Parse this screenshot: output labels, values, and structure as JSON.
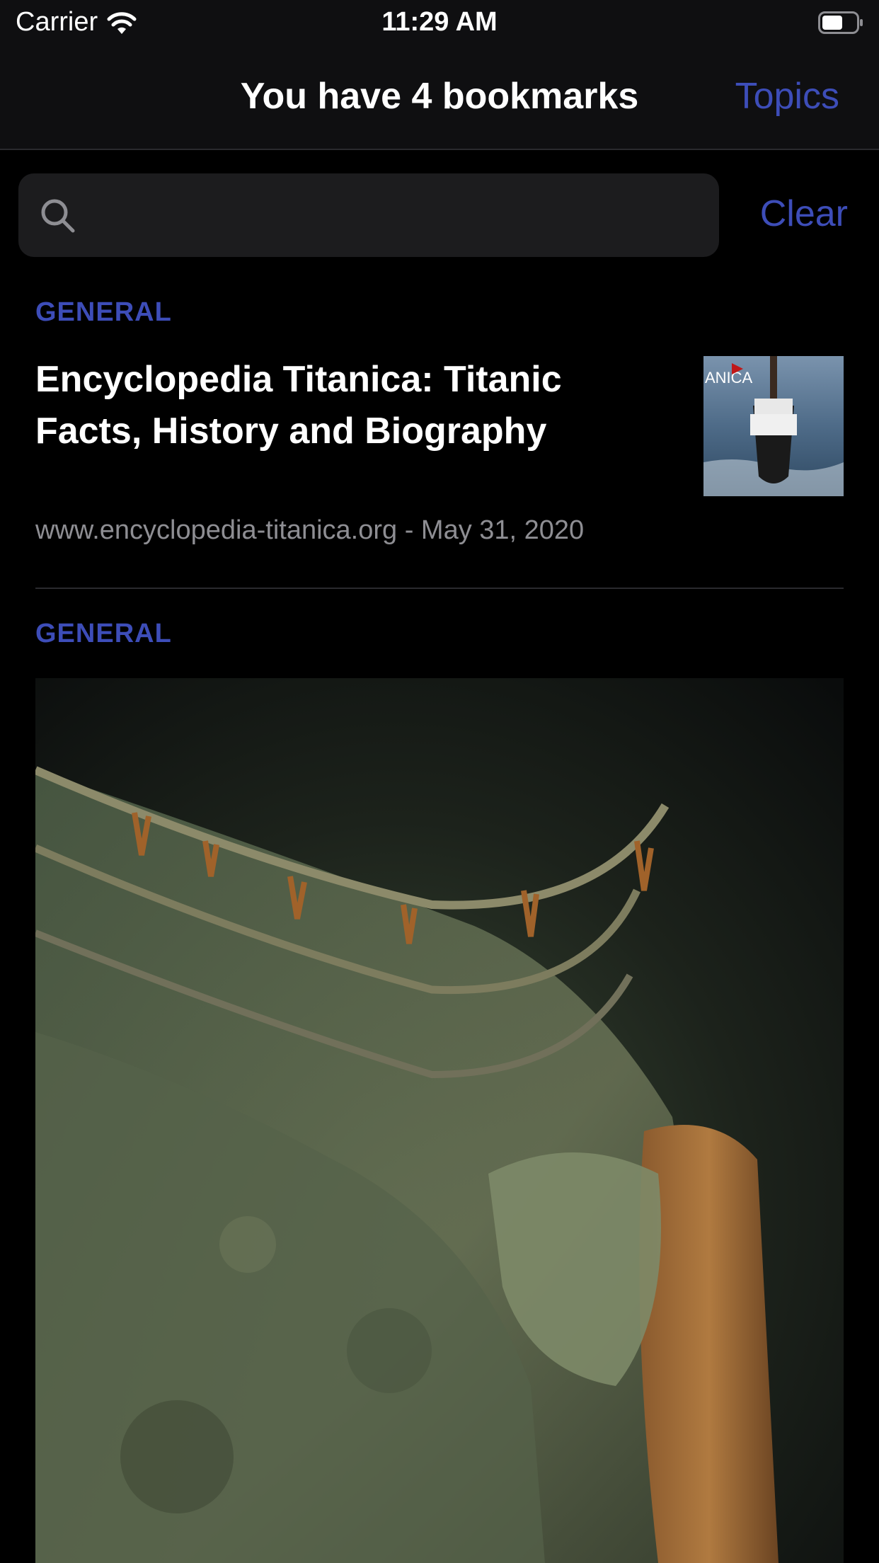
{
  "status_bar": {
    "carrier": "Carrier",
    "time": "11:29 AM",
    "icons": [
      "wifi-icon",
      "battery-icon"
    ]
  },
  "nav": {
    "title": "You have 4 bookmarks",
    "topics_label": "Topics"
  },
  "search": {
    "value": "",
    "placeholder": "",
    "clear_label": "Clear"
  },
  "bookmarks": [
    {
      "category": "GENERAL",
      "title": "Encyclopedia Titanica: Titanic Facts, History and Biography",
      "meta": "www.encyclopedia-titanica.org - May 31, 2020",
      "thumbnail_text": "ANICA"
    },
    {
      "category": "GENERAL"
    }
  ],
  "colors": {
    "accent": "#3d4db8",
    "background": "#000000",
    "bar": "#0f0f11",
    "search_field": "#1c1c1e",
    "secondary_text": "#8e8e93"
  }
}
